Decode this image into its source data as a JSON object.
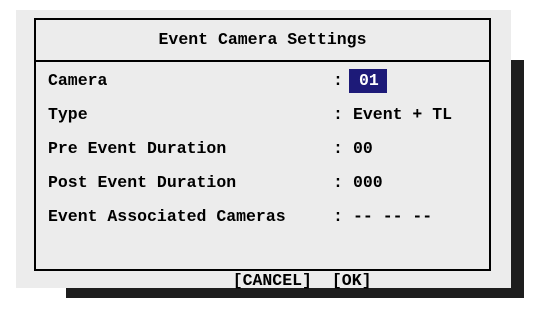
{
  "dialog": {
    "title": "Event Camera Settings",
    "fields": [
      {
        "label": "Camera",
        "value": "01",
        "selected": true
      },
      {
        "label": "Type",
        "value": "Event + TL"
      },
      {
        "label": "Pre Event Duration",
        "value": "00"
      },
      {
        "label": "Post Event Duration",
        "value": "000"
      },
      {
        "label": "Event Associated Cameras",
        "value": "-- -- --"
      }
    ],
    "colon": ":",
    "buttons": {
      "cancel_label": "[CANCEL]",
      "ok_label": "[OK]"
    }
  },
  "colors": {
    "dialog_background": "#ececec",
    "selection_background": "#1d1a78",
    "selection_text": "#ffffff",
    "shadow": "#1e1e1e"
  }
}
